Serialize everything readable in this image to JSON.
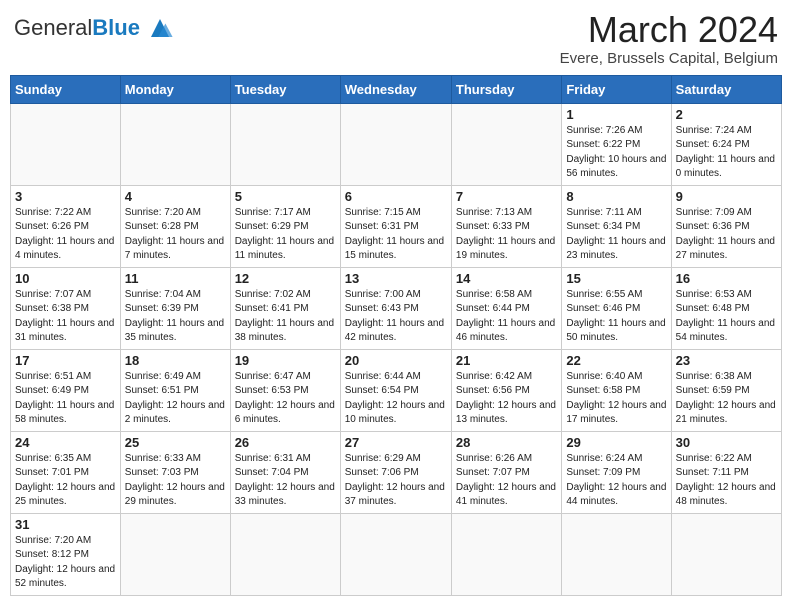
{
  "header": {
    "logo_general": "General",
    "logo_blue": "Blue",
    "month": "March 2024",
    "location": "Evere, Brussels Capital, Belgium"
  },
  "weekdays": [
    "Sunday",
    "Monday",
    "Tuesday",
    "Wednesday",
    "Thursday",
    "Friday",
    "Saturday"
  ],
  "weeks": [
    [
      {
        "day": "",
        "info": ""
      },
      {
        "day": "",
        "info": ""
      },
      {
        "day": "",
        "info": ""
      },
      {
        "day": "",
        "info": ""
      },
      {
        "day": "",
        "info": ""
      },
      {
        "day": "1",
        "info": "Sunrise: 7:26 AM\nSunset: 6:22 PM\nDaylight: 10 hours and 56 minutes."
      },
      {
        "day": "2",
        "info": "Sunrise: 7:24 AM\nSunset: 6:24 PM\nDaylight: 11 hours and 0 minutes."
      }
    ],
    [
      {
        "day": "3",
        "info": "Sunrise: 7:22 AM\nSunset: 6:26 PM\nDaylight: 11 hours and 4 minutes."
      },
      {
        "day": "4",
        "info": "Sunrise: 7:20 AM\nSunset: 6:28 PM\nDaylight: 11 hours and 7 minutes."
      },
      {
        "day": "5",
        "info": "Sunrise: 7:17 AM\nSunset: 6:29 PM\nDaylight: 11 hours and 11 minutes."
      },
      {
        "day": "6",
        "info": "Sunrise: 7:15 AM\nSunset: 6:31 PM\nDaylight: 11 hours and 15 minutes."
      },
      {
        "day": "7",
        "info": "Sunrise: 7:13 AM\nSunset: 6:33 PM\nDaylight: 11 hours and 19 minutes."
      },
      {
        "day": "8",
        "info": "Sunrise: 7:11 AM\nSunset: 6:34 PM\nDaylight: 11 hours and 23 minutes."
      },
      {
        "day": "9",
        "info": "Sunrise: 7:09 AM\nSunset: 6:36 PM\nDaylight: 11 hours and 27 minutes."
      }
    ],
    [
      {
        "day": "10",
        "info": "Sunrise: 7:07 AM\nSunset: 6:38 PM\nDaylight: 11 hours and 31 minutes."
      },
      {
        "day": "11",
        "info": "Sunrise: 7:04 AM\nSunset: 6:39 PM\nDaylight: 11 hours and 35 minutes."
      },
      {
        "day": "12",
        "info": "Sunrise: 7:02 AM\nSunset: 6:41 PM\nDaylight: 11 hours and 38 minutes."
      },
      {
        "day": "13",
        "info": "Sunrise: 7:00 AM\nSunset: 6:43 PM\nDaylight: 11 hours and 42 minutes."
      },
      {
        "day": "14",
        "info": "Sunrise: 6:58 AM\nSunset: 6:44 PM\nDaylight: 11 hours and 46 minutes."
      },
      {
        "day": "15",
        "info": "Sunrise: 6:55 AM\nSunset: 6:46 PM\nDaylight: 11 hours and 50 minutes."
      },
      {
        "day": "16",
        "info": "Sunrise: 6:53 AM\nSunset: 6:48 PM\nDaylight: 11 hours and 54 minutes."
      }
    ],
    [
      {
        "day": "17",
        "info": "Sunrise: 6:51 AM\nSunset: 6:49 PM\nDaylight: 11 hours and 58 minutes."
      },
      {
        "day": "18",
        "info": "Sunrise: 6:49 AM\nSunset: 6:51 PM\nDaylight: 12 hours and 2 minutes."
      },
      {
        "day": "19",
        "info": "Sunrise: 6:47 AM\nSunset: 6:53 PM\nDaylight: 12 hours and 6 minutes."
      },
      {
        "day": "20",
        "info": "Sunrise: 6:44 AM\nSunset: 6:54 PM\nDaylight: 12 hours and 10 minutes."
      },
      {
        "day": "21",
        "info": "Sunrise: 6:42 AM\nSunset: 6:56 PM\nDaylight: 12 hours and 13 minutes."
      },
      {
        "day": "22",
        "info": "Sunrise: 6:40 AM\nSunset: 6:58 PM\nDaylight: 12 hours and 17 minutes."
      },
      {
        "day": "23",
        "info": "Sunrise: 6:38 AM\nSunset: 6:59 PM\nDaylight: 12 hours and 21 minutes."
      }
    ],
    [
      {
        "day": "24",
        "info": "Sunrise: 6:35 AM\nSunset: 7:01 PM\nDaylight: 12 hours and 25 minutes."
      },
      {
        "day": "25",
        "info": "Sunrise: 6:33 AM\nSunset: 7:03 PM\nDaylight: 12 hours and 29 minutes."
      },
      {
        "day": "26",
        "info": "Sunrise: 6:31 AM\nSunset: 7:04 PM\nDaylight: 12 hours and 33 minutes."
      },
      {
        "day": "27",
        "info": "Sunrise: 6:29 AM\nSunset: 7:06 PM\nDaylight: 12 hours and 37 minutes."
      },
      {
        "day": "28",
        "info": "Sunrise: 6:26 AM\nSunset: 7:07 PM\nDaylight: 12 hours and 41 minutes."
      },
      {
        "day": "29",
        "info": "Sunrise: 6:24 AM\nSunset: 7:09 PM\nDaylight: 12 hours and 44 minutes."
      },
      {
        "day": "30",
        "info": "Sunrise: 6:22 AM\nSunset: 7:11 PM\nDaylight: 12 hours and 48 minutes."
      }
    ],
    [
      {
        "day": "31",
        "info": "Sunrise: 7:20 AM\nSunset: 8:12 PM\nDaylight: 12 hours and 52 minutes."
      },
      {
        "day": "",
        "info": ""
      },
      {
        "day": "",
        "info": ""
      },
      {
        "day": "",
        "info": ""
      },
      {
        "day": "",
        "info": ""
      },
      {
        "day": "",
        "info": ""
      },
      {
        "day": "",
        "info": ""
      }
    ]
  ]
}
